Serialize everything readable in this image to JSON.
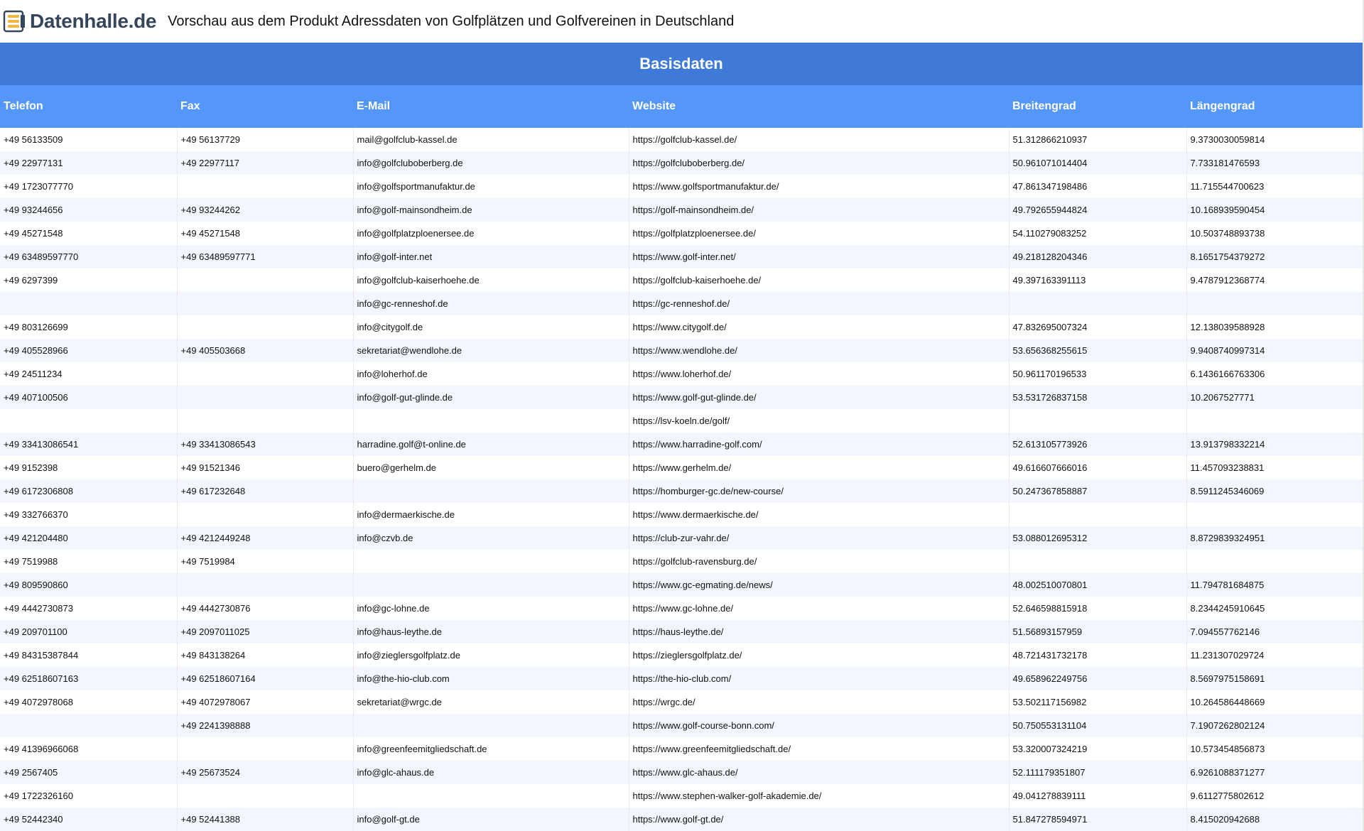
{
  "header": {
    "logo_text": "Datenhalle.de",
    "title": "Vorschau aus dem Produkt Adressdaten von Golfplätzen und Golfvereinen in Deutschland"
  },
  "section": {
    "title": "Basisdaten"
  },
  "table": {
    "columns": [
      "Telefon",
      "Fax",
      "E-Mail",
      "Website",
      "Breitengrad",
      "Längengrad"
    ],
    "rows": [
      [
        "+49 56133509",
        "+49 56137729",
        "mail@golfclub-kassel.de",
        "https://golfclub-kassel.de/",
        "51.312866210937",
        "9.3730030059814"
      ],
      [
        "+49 22977131",
        "+49 22977117",
        "info@golfcluboberberg.de",
        "https://golfcluboberberg.de/",
        "50.961071014404",
        "7.733181476593"
      ],
      [
        "+49 1723077770",
        "",
        "info@golfsportmanufaktur.de",
        "https://www.golfsportmanufaktur.de/",
        "47.861347198486",
        "11.715544700623"
      ],
      [
        "+49 93244656",
        "+49 93244262",
        "info@golf-mainsondheim.de",
        "https://golf-mainsondheim.de/",
        "49.792655944824",
        "10.168939590454"
      ],
      [
        "+49 45271548",
        "+49 45271548",
        "info@golfplatzploenersee.de",
        "https://golfplatzploenersee.de/",
        "54.110279083252",
        "10.503748893738"
      ],
      [
        "+49 63489597770",
        "+49 63489597771",
        "info@golf-inter.net",
        "https://www.golf-inter.net/",
        "49.218128204346",
        "8.1651754379272"
      ],
      [
        "+49 6297399",
        "",
        "info@golfclub-kaiserhoehe.de",
        "https://golfclub-kaiserhoehe.de/",
        "49.397163391113",
        "9.4787912368774"
      ],
      [
        "",
        "",
        "info@gc-renneshof.de",
        "https://gc-renneshof.de/",
        "",
        ""
      ],
      [
        "+49 803126699",
        "",
        "info@citygolf.de",
        "https://www.citygolf.de/",
        "47.832695007324",
        "12.138039588928"
      ],
      [
        "+49 405528966",
        "+49 405503668",
        "sekretariat@wendlohe.de",
        "https://www.wendlohe.de/",
        "53.656368255615",
        "9.9408740997314"
      ],
      [
        "+49 24511234",
        "",
        "info@loherhof.de",
        "https://www.loherhof.de/",
        "50.961170196533",
        "6.1436166763306"
      ],
      [
        "+49 407100506",
        "",
        "info@golf-gut-glinde.de",
        "https://www.golf-gut-glinde.de/",
        "53.531726837158",
        "10.2067527771"
      ],
      [
        "",
        "",
        "",
        "https://lsv-koeln.de/golf/",
        "",
        ""
      ],
      [
        "+49 33413086541",
        "+49 33413086543",
        "harradine.golf@t-online.de",
        "https://www.harradine-golf.com/",
        "52.613105773926",
        "13.913798332214"
      ],
      [
        "+49 9152398",
        "+49 91521346",
        "buero@gerhelm.de",
        "https://www.gerhelm.de/",
        "49.616607666016",
        "11.457093238831"
      ],
      [
        "+49 6172306808",
        "+49 617232648",
        "",
        "https://homburger-gc.de/new-course/",
        "50.247367858887",
        "8.5911245346069"
      ],
      [
        "+49 332766370",
        "",
        "info@dermaerkische.de",
        "https://www.dermaerkische.de/",
        "",
        ""
      ],
      [
        "+49 421204480",
        "+49 4212449248",
        "info@czvb.de",
        "https://club-zur-vahr.de/",
        "53.088012695312",
        "8.8729839324951"
      ],
      [
        "+49 7519988",
        "+49 7519984",
        "",
        "https://golfclub-ravensburg.de/",
        "",
        ""
      ],
      [
        "+49 809590860",
        "",
        "",
        "https://www.gc-egmating.de/news/",
        "48.002510070801",
        "11.794781684875"
      ],
      [
        "+49 4442730873",
        "+49 4442730876",
        "info@gc-lohne.de",
        "https://www.gc-lohne.de/",
        "52.646598815918",
        "8.2344245910645"
      ],
      [
        "+49 209701100",
        "+49 2097011025",
        "info@haus-leythe.de",
        "https://haus-leythe.de/",
        "51.56893157959",
        "7.094557762146"
      ],
      [
        "+49 84315387844",
        "+49 843138264",
        "info@zieglersgolfplatz.de",
        "https://zieglersgolfplatz.de/",
        "48.721431732178",
        "11.231307029724"
      ],
      [
        "+49 62518607163",
        "+49 62518607164",
        "info@the-hio-club.com",
        "https://the-hio-club.com/",
        "49.658962249756",
        "8.5697975158691"
      ],
      [
        "+49 4072978068",
        "+49 4072978067",
        "sekretariat@wrgc.de",
        "https://wrgc.de/",
        "53.502117156982",
        "10.264586448669"
      ],
      [
        "",
        "+49 2241398888",
        "",
        "https://www.golf-course-bonn.com/",
        "50.750553131104",
        "7.1907262802124"
      ],
      [
        "+49 41396966068",
        "",
        "info@greenfeemitgliedschaft.de",
        "https://www.greenfeemitgliedschaft.de/",
        "53.320007324219",
        "10.573454856873"
      ],
      [
        "+49 2567405",
        "+49 25673524",
        "info@glc-ahaus.de",
        "https://www.glc-ahaus.de/",
        "52.111179351807",
        "6.9261088371277"
      ],
      [
        "+49 1722326160",
        "",
        "",
        "https://www.stephen-walker-golf-akademie.de/",
        "49.041278839111",
        "9.6112775802612"
      ],
      [
        "+49 52442340",
        "+49 52441388",
        "info@golf-gt.de",
        "https://www.golf-gt.de/",
        "51.847278594971",
        "8.415020942688"
      ]
    ]
  },
  "colors": {
    "band": "#3f7ad8",
    "header_row": "#5597f9",
    "stripe": "#f3f7fd",
    "logo_text": "#35465c"
  },
  "icons": {
    "logo": "database-stack-icon"
  }
}
